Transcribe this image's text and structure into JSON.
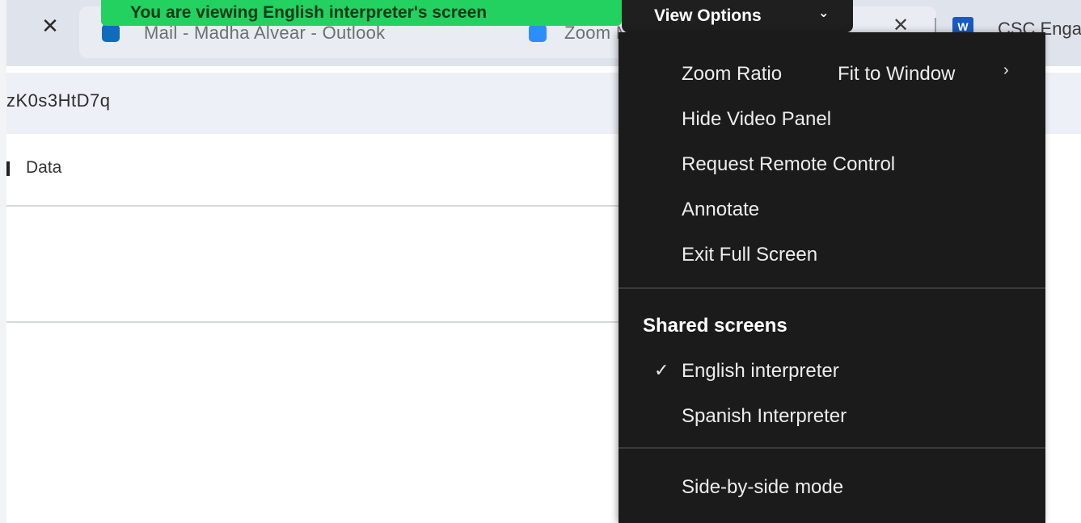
{
  "browser": {
    "tabs": [
      {
        "title": "Mail - Madha Alvear - Outlook"
      },
      {
        "title": "Zoom Meeting"
      },
      {
        "title": "CSC Enga"
      }
    ],
    "url_fragment": "zK0s3HtD7q",
    "bookmark_label": "Data"
  },
  "zoom": {
    "banner_text": "You are viewing English interpreter's screen",
    "view_options_label": "View Options",
    "menu": {
      "items": [
        {
          "label": "Zoom Ratio",
          "value": "Fit to Window"
        },
        {
          "label": "Hide Video Panel"
        },
        {
          "label": "Request Remote Control"
        },
        {
          "label": "Annotate"
        },
        {
          "label": "Exit Full Screen"
        }
      ],
      "shared_screens_heading": "Shared screens",
      "shared_screens": [
        {
          "label": "English interpreter",
          "checked": true
        },
        {
          "label": "Spanish Interpreter",
          "checked": false
        }
      ],
      "side_by_side_label": "Side-by-side mode"
    }
  },
  "colors": {
    "banner_green": "#23d160",
    "menu_bg": "#1b1b1b",
    "word_blue": "#185abd"
  },
  "icons": {
    "check": "✓",
    "chevron_right": "›",
    "chevron_down": "⌄",
    "close": "✕"
  }
}
